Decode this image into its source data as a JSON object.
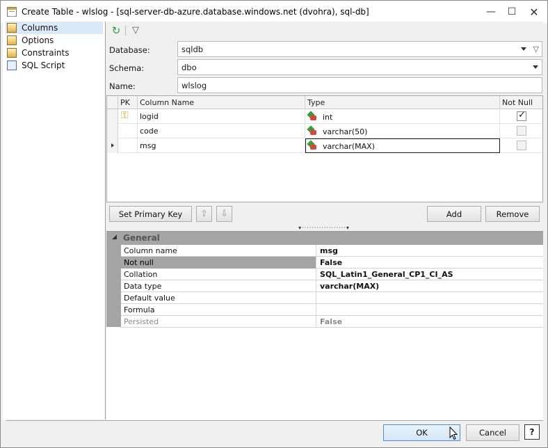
{
  "window": {
    "title": "Create Table - wlslog - [sql-server-db-azure.database.windows.net (dvohra), sql-db]",
    "minimize": "—",
    "maximize": "☐",
    "close": "✕"
  },
  "nav": {
    "items": [
      {
        "label": "Columns",
        "icon": "columns-icon",
        "selected": true
      },
      {
        "label": "Options",
        "icon": "options-icon"
      },
      {
        "label": "Constraints",
        "icon": "constraints-icon"
      },
      {
        "label": "SQL Script",
        "icon": "sql-script-icon"
      }
    ]
  },
  "toolbar": {
    "refresh_icon": "↻",
    "filter_icon": "▽"
  },
  "form": {
    "database_label": "Database:",
    "database_value": "sqldb",
    "schema_label": "Schema:",
    "schema_value": "dbo",
    "name_label": "Name:",
    "name_value": "wlslog",
    "filter_glyph": "▽"
  },
  "grid": {
    "headers": {
      "pk": "PK",
      "column_name": "Column Name",
      "type": "Type",
      "not_null": "Not Null"
    },
    "rows": [
      {
        "pk": true,
        "name": "logid",
        "type": "int",
        "not_null": true
      },
      {
        "pk": false,
        "name": "code",
        "type": "varchar(50)",
        "not_null": false
      },
      {
        "pk": false,
        "name": "msg",
        "type": "varchar(MAX)",
        "not_null": false,
        "current": true
      }
    ],
    "key_glyph": "⚿"
  },
  "actions": {
    "set_primary_key": "Set Primary Key",
    "move_up": "⇧",
    "move_down": "⇩",
    "add": "Add",
    "remove": "Remove"
  },
  "splitter": {
    "glyph": "▾··················▾"
  },
  "properties": {
    "category": "General",
    "toggle": "◢",
    "rows": [
      {
        "name": "Column name",
        "value": "msg"
      },
      {
        "name": "Not null",
        "value": "False"
      },
      {
        "name": "Collation",
        "value": "SQL_Latin1_General_CP1_CI_AS"
      },
      {
        "name": "Data type",
        "value": "varchar(MAX)"
      },
      {
        "name": "Default value",
        "value": ""
      },
      {
        "name": "Formula",
        "value": ""
      },
      {
        "name": "Persisted",
        "value": "False"
      }
    ]
  },
  "footer": {
    "ok": "OK",
    "cancel": "Cancel",
    "help": "?"
  }
}
